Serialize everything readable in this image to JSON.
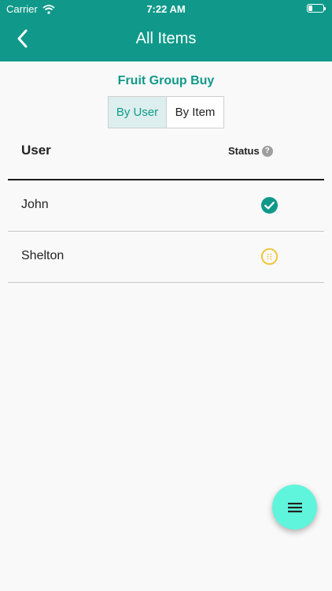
{
  "statusbar": {
    "carrier": "Carrier",
    "time": "7:22 AM"
  },
  "header": {
    "title": "All Items"
  },
  "group": {
    "title": "Fruit Group Buy"
  },
  "tabs": [
    {
      "label": "By User",
      "active": true
    },
    {
      "label": "By Item",
      "active": false
    }
  ],
  "table": {
    "headers": {
      "user": "User",
      "status": "Status"
    },
    "rows": [
      {
        "name": "John",
        "status": "completed"
      },
      {
        "name": "Shelton",
        "status": "pending"
      }
    ]
  },
  "icons": {
    "back": "chevron-left-icon",
    "help": "question-icon",
    "completed": "check-circle-icon",
    "pending": "pending-circle-icon",
    "menu": "menu-icon"
  },
  "colors": {
    "primary": "#10998a",
    "pending": "#f1c232",
    "fab": "#5ff5dc",
    "tab_active_bg": "#dceeed"
  }
}
